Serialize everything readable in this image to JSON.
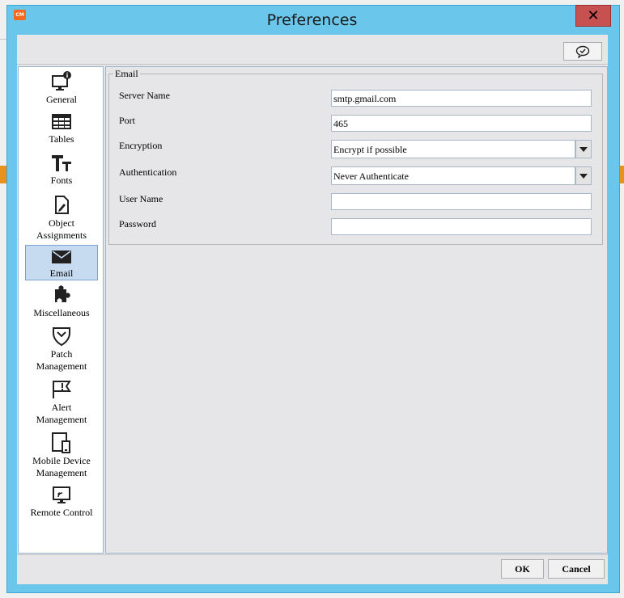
{
  "window": {
    "title": "Preferences",
    "app_badge": "CM",
    "close_glyph": "✕"
  },
  "toolbar": {
    "feedback_icon": "speech-bubble-check-icon"
  },
  "sidebar": {
    "items": [
      {
        "label": "General",
        "icon": "monitor-info-icon"
      },
      {
        "label": "Tables",
        "icon": "table-grid-icon"
      },
      {
        "label": "Fonts",
        "icon": "text-tt-icon"
      },
      {
        "label": "Object Assignments",
        "icon": "document-pen-icon"
      },
      {
        "label": "Email",
        "icon": "envelope-icon",
        "selected": true
      },
      {
        "label": "Miscellaneous",
        "icon": "puzzle-icon"
      },
      {
        "label": "Patch Management",
        "icon": "shield-icon"
      },
      {
        "label": "Alert Management",
        "icon": "flag-icon"
      },
      {
        "label": "Mobile Device Management",
        "icon": "devices-icon"
      },
      {
        "label": "Remote Control",
        "icon": "remote-screen-icon"
      }
    ]
  },
  "email": {
    "group_title": "Email",
    "server_name": {
      "label": "Server Name",
      "value": "smtp.gmail.com"
    },
    "port": {
      "label": "Port",
      "value": "465"
    },
    "encryption": {
      "label": "Encryption",
      "value": "Encrypt if possible"
    },
    "authentication": {
      "label": "Authentication",
      "value": "Never Authenticate"
    },
    "user_name": {
      "label": "User Name",
      "value": ""
    },
    "password": {
      "label": "Password",
      "value": ""
    }
  },
  "buttons": {
    "ok": "OK",
    "cancel": "Cancel"
  },
  "colors": {
    "title_bar": "#6ac6ea",
    "close": "#c75050",
    "selected": "#c6daf0"
  }
}
